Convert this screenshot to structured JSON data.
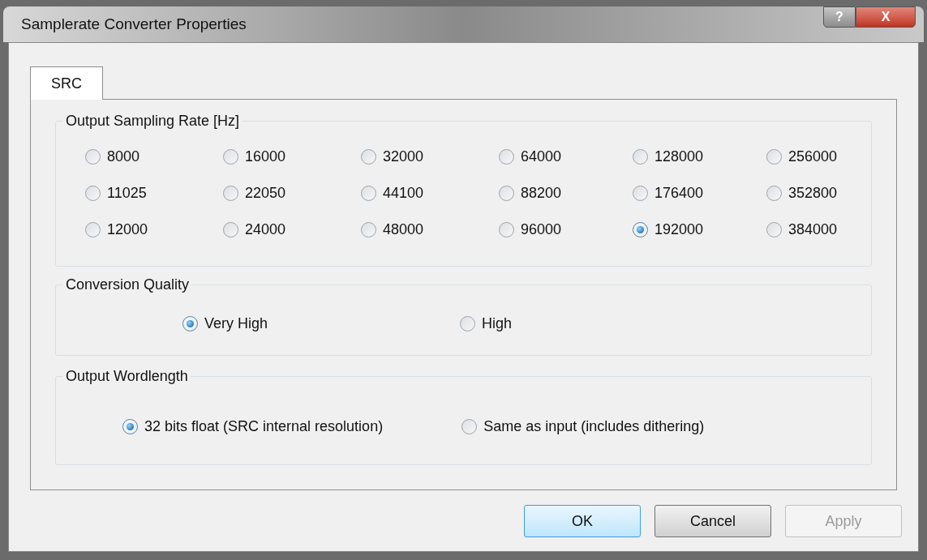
{
  "window": {
    "title": "Samplerate Converter Properties"
  },
  "title_buttons": [
    {
      "kind": "help",
      "label": "?"
    },
    {
      "kind": "close",
      "label": "X"
    }
  ],
  "tabs": [
    {
      "label": "SRC",
      "selected": true
    }
  ],
  "sampling_rate": {
    "title": "Output Sampling Rate [Hz]",
    "options": [
      {
        "label": "8000",
        "selected": false
      },
      {
        "label": "16000",
        "selected": false
      },
      {
        "label": "32000",
        "selected": false
      },
      {
        "label": "64000",
        "selected": false
      },
      {
        "label": "128000",
        "selected": false
      },
      {
        "label": "256000",
        "selected": false
      },
      {
        "label": "11025",
        "selected": false
      },
      {
        "label": "22050",
        "selected": false
      },
      {
        "label": "44100",
        "selected": false
      },
      {
        "label": "88200",
        "selected": false
      },
      {
        "label": "176400",
        "selected": false
      },
      {
        "label": "352800",
        "selected": false
      },
      {
        "label": "12000",
        "selected": false
      },
      {
        "label": "24000",
        "selected": false
      },
      {
        "label": "48000",
        "selected": false
      },
      {
        "label": "96000",
        "selected": false
      },
      {
        "label": "192000",
        "selected": true
      },
      {
        "label": "384000",
        "selected": false
      }
    ]
  },
  "conversion_quality": {
    "title": "Conversion Quality",
    "options": [
      {
        "label": "Very High",
        "selected": true
      },
      {
        "label": "High",
        "selected": false
      }
    ]
  },
  "output_wordlength": {
    "title": "Output Wordlength",
    "options": [
      {
        "label": "32 bits float (SRC internal resolution)",
        "selected": true
      },
      {
        "label": "Same as input (includes dithering)",
        "selected": false
      }
    ]
  },
  "buttons": [
    {
      "label": "OK",
      "default": true,
      "disabled": false
    },
    {
      "label": "Cancel",
      "default": false,
      "disabled": false
    },
    {
      "label": "Apply",
      "default": false,
      "disabled": true
    }
  ]
}
